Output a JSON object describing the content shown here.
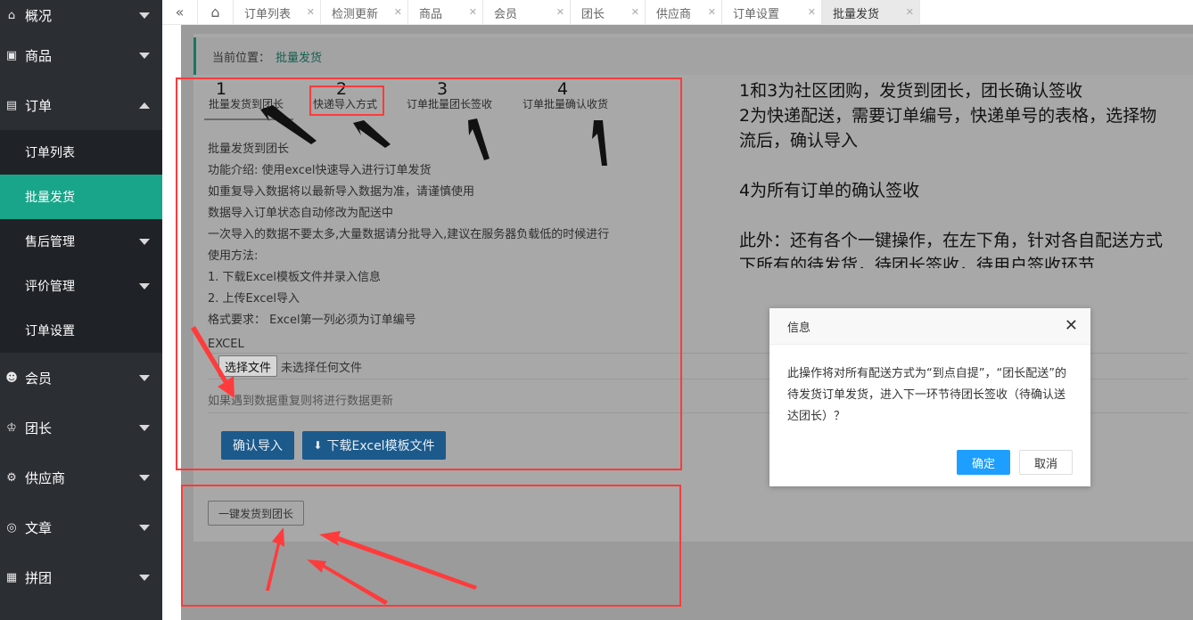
{
  "sidebar": {
    "items": [
      {
        "label": "概况",
        "icon": "home-icon"
      },
      {
        "label": "商品",
        "icon": "product-icon"
      },
      {
        "label": "订单",
        "icon": "order-icon"
      },
      {
        "label": "会员",
        "icon": "users-icon"
      },
      {
        "label": "团长",
        "icon": "crown-icon"
      },
      {
        "label": "供应商",
        "icon": "supplier-icon"
      },
      {
        "label": "文章",
        "icon": "compass-icon"
      },
      {
        "label": "拼团",
        "icon": "group-icon"
      }
    ],
    "order_sub": [
      "订单列表",
      "批量发货",
      "售后管理",
      "评价管理",
      "订单设置"
    ]
  },
  "tabs": [
    "订单列表",
    "检测更新",
    "商品",
    "会员",
    "团长",
    "供应商",
    "订单设置",
    "批量发货"
  ],
  "breadcrumb": {
    "prefix": "当前位置：",
    "current": "批量发货"
  },
  "subtabs": [
    "批量发货到团长",
    "快递导入方式",
    "订单批量团长签收",
    "订单批量确认收货"
  ],
  "subtab_numbers": [
    "1",
    "2",
    "3",
    "4"
  ],
  "desc_lines": [
    "批量发货到团长",
    "功能介绍: 使用excel快速导入进行订单发货",
    "如重复导入数据将以最新导入数据为准，请谨慎使用",
    "数据导入订单状态自动修改为配送中",
    "一次导入的数据不要太多,大量数据请分批导入,建议在服务器负载低的时候进行",
    "使用方法:",
    "1. 下载Excel模板文件并录入信息",
    "2. 上传Excel导入",
    "格式要求：  Excel第一列必须为订单编号"
  ],
  "excel_label": "EXCEL",
  "file": {
    "button": "选择文件",
    "status": "未选择任何文件"
  },
  "duplicate_note": "如果遇到数据重复则将进行数据更新",
  "buttons": {
    "confirm_import": "确认导入",
    "download_template": "下载Excel模板文件",
    "one_key": "一键发货到团长"
  },
  "annotations": [
    "1和3为社区团购，发货到团长，团长确认签收",
    "2为快递配送，需要订单编号，快递单号的表格，选择物",
    "流后，确认导入",
    "4为所有订单的确认签收",
    "此外：还有各个一键操作，在左下角，针对各自配送方式",
    "下所有的待发货，待团长签收，待用户签收环节"
  ],
  "dialog": {
    "title": "信息",
    "body": "此操作将对所有配送方式为“到点自提”，“团长配送”的待发货订单发货，进入下一环节待团长签收（待确认送达团长）？",
    "ok": "确定",
    "cancel": "取消"
  },
  "colors": {
    "sidebar": "#2b2e33",
    "active": "#19a589",
    "primary": "#1e9fff",
    "annotation": "#ff3b3b"
  }
}
